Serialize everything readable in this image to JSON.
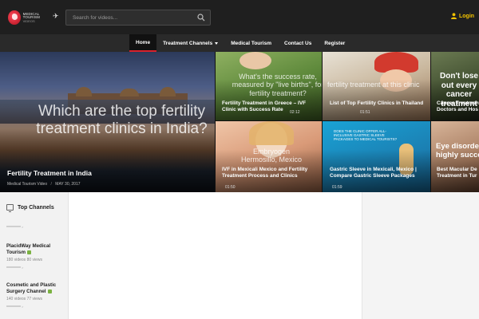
{
  "header": {
    "logo_line1": "MEDICAL TOURISM",
    "logo_line2": "VIDEOS",
    "search_placeholder": "Search for videos...",
    "login_label": "Login",
    "accent": "#d8212b",
    "login_color": "#f2c200"
  },
  "nav": {
    "items": [
      {
        "label": "Home",
        "active": true
      },
      {
        "label": "Treatment Channels",
        "dropdown": true
      },
      {
        "label": "Medical Tourism"
      },
      {
        "label": "Contact Us"
      },
      {
        "label": "Register"
      }
    ]
  },
  "hero": {
    "main": {
      "bigtext": "Which are the top fertility treatment clinics in India?",
      "title": "Fertility Treatment in India",
      "channel": "Medical Tourism Video",
      "date": "MAY 30, 2017"
    },
    "tiles": [
      {
        "bigtext": "What's the success rate, measured by \"live births\", for fertility treatment?",
        "title": "Fertility Treatment in Greece – IVF Clinic with Success Rate",
        "time": "02:12"
      },
      {
        "bigtext": "fertility treatment at this clinic",
        "title": "List of Top Fertility Clinics in Thailand",
        "time": "01:51"
      },
      {
        "bigtext": "Don't lose out every cancer treatment",
        "title": "Cancer Treatment Doctors and Hos"
      },
      {
        "bigtext": "Embryogen Hermosillo, Mexico",
        "title": "IVF in Mexicali Mexico and Fertility Treatment Process and Clinics",
        "time": "01:50"
      },
      {
        "bigtext": "DOES THE CLINIC OFFER ALL-INCLUSIVE GASTRIC SLEEVE PACKAGES TO MEDICAL TOURISTS?",
        "title": "Gastric Sleeve in Mexicali, Mexico | Compare Gastric Sleeve Packages",
        "time": "01:59"
      },
      {
        "bigtext": "Eye disorde highly succe",
        "title": "Best Macular De Treatment in Tur"
      }
    ]
  },
  "sidebar": {
    "heading": "Top Channels",
    "channels": [
      {
        "name": "PlacidWay Medical Tourism",
        "stats": "180 videos 80 views"
      },
      {
        "name": "Cosmetic and Plastic Surgery Channel",
        "stats": "140 videos 77 views"
      }
    ]
  }
}
